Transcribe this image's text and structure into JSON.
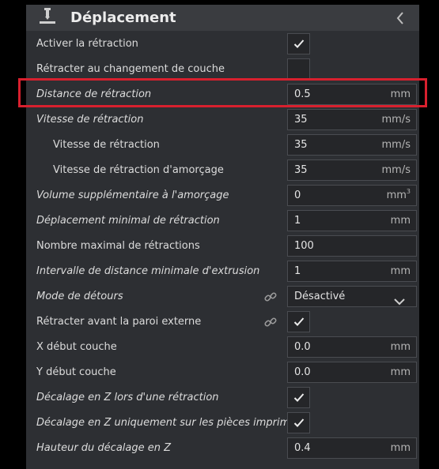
{
  "header": {
    "title": "Déplacement",
    "icon": "travel-settings-icon",
    "collapse_icon": "chevron-left-icon"
  },
  "settings": [
    {
      "label": "Activer la rétraction",
      "type": "checkbox",
      "checked": true
    },
    {
      "label": "Rétracter au changement de couche",
      "type": "checkbox",
      "checked": false
    },
    {
      "label": "Distance de rétraction",
      "type": "number",
      "value": "0.5",
      "unit": "mm",
      "highlighted": true
    },
    {
      "label": "Vitesse de rétraction",
      "type": "number",
      "value": "35",
      "unit": "mm/s"
    },
    {
      "label": "Vitesse de rétraction",
      "type": "number",
      "value": "35",
      "unit": "mm/s",
      "sub": true
    },
    {
      "label": "Vitesse de rétraction d'amorçage",
      "type": "number",
      "value": "35",
      "unit": "mm/s",
      "sub": true
    },
    {
      "label": "Volume supplémentaire à l'amorçage",
      "type": "number",
      "value": "0",
      "unit": "mm",
      "unit_sup": "3"
    },
    {
      "label": "Déplacement minimal de rétraction",
      "type": "number",
      "value": "1",
      "unit": "mm"
    },
    {
      "label": "Nombre maximal de rétractions",
      "type": "number",
      "value": "100",
      "unit": ""
    },
    {
      "label": "Intervalle de distance minimale d'extrusion",
      "type": "number",
      "value": "1",
      "unit": "mm"
    },
    {
      "label": "Mode de détours",
      "type": "dropdown",
      "value": "Désactivé",
      "linked": true
    },
    {
      "label": "Rétracter avant la paroi externe",
      "type": "checkbox",
      "checked": true,
      "linked": true
    },
    {
      "label": "X début couche",
      "type": "number",
      "value": "0.0",
      "unit": "mm"
    },
    {
      "label": "Y début couche",
      "type": "number",
      "value": "0.0",
      "unit": "mm"
    },
    {
      "label": "Décalage en Z lors d'une rétraction",
      "type": "checkbox",
      "checked": true
    },
    {
      "label": "Décalage en Z uniquement sur les pièces imprimées",
      "type": "checkbox",
      "checked": true
    },
    {
      "label": "Hauteur du décalage en Z",
      "type": "number",
      "value": "0.4",
      "unit": "mm"
    }
  ],
  "colors": {
    "panel": "#2d2f33",
    "header": "#3a3c40",
    "field": "#252629",
    "highlight": "#d8202e"
  }
}
